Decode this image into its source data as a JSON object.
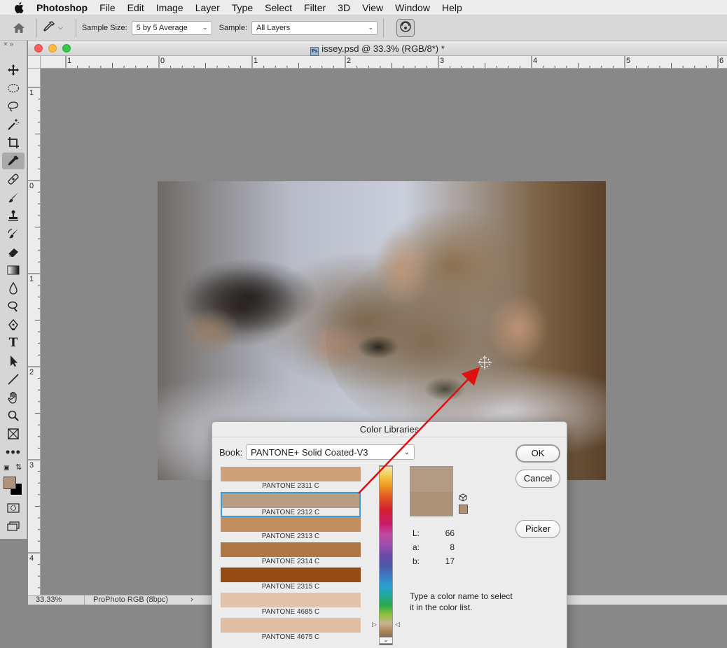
{
  "menubar": {
    "app": "Photoshop",
    "items": [
      "File",
      "Edit",
      "Image",
      "Layer",
      "Type",
      "Select",
      "Filter",
      "3D",
      "View",
      "Window",
      "Help"
    ]
  },
  "options": {
    "sample_size_label": "Sample Size:",
    "sample_size_value": "5 by 5 Average",
    "sample_label": "Sample:",
    "sample_value": "All Layers"
  },
  "document": {
    "title": "issey.psd @ 33.3% (RGB/8*) *",
    "ruler_h": [
      "1",
      "0",
      "1",
      "2",
      "3",
      "4",
      "5",
      "6"
    ],
    "ruler_v": [
      "1",
      "0",
      "1",
      "2",
      "3",
      "4"
    ],
    "zoom": "33.33%",
    "profile": "ProPhoto RGB (8bpc)",
    "status_arrow": "›"
  },
  "colors": {
    "foreground": "#b39279",
    "background": "#000000",
    "accent": "#3a9bd6",
    "arrow": "#e01010"
  },
  "dialog": {
    "title": "Color Libraries",
    "book_label": "Book:",
    "book_value": "PANTONE+ Solid Coated-V3",
    "swatches": [
      {
        "name": "PANTONE 2311 C",
        "color": "#cda17a"
      },
      {
        "name": "PANTONE 2312 C",
        "color": "#b59c82"
      },
      {
        "name": "PANTONE 2313 C",
        "color": "#c38f5e"
      },
      {
        "name": "PANTONE 2314 C",
        "color": "#ae7845"
      },
      {
        "name": "PANTONE 2315 C",
        "color": "#934a14"
      },
      {
        "name": "PANTONE 4685 C",
        "color": "#e2c3ab"
      },
      {
        "name": "PANTONE 4675 C",
        "color": "#dfc0a4"
      }
    ],
    "selected_index": 1,
    "ok_label": "OK",
    "cancel_label": "Cancel",
    "picker_label": "Picker",
    "lab": {
      "L": "66",
      "a": "8",
      "b": "17"
    },
    "lab_labels": {
      "L": "L:",
      "a": "a:",
      "b": "b:"
    },
    "hint": "Type a color name to select it in the color list."
  },
  "icons": {
    "tools": [
      "move-icon",
      "marquee-icon",
      "lasso-icon",
      "magic-wand-icon",
      "crop-icon",
      "eyedropper-icon",
      "healing-brush-icon",
      "brush-icon",
      "clone-stamp-icon",
      "history-brush-icon",
      "eraser-icon",
      "gradient-icon",
      "blur-icon",
      "dodge-icon",
      "pen-icon",
      "type-icon",
      "path-selection-icon",
      "line-icon",
      "hand-icon",
      "zoom-icon",
      "frame-icon",
      "more-icon"
    ]
  }
}
